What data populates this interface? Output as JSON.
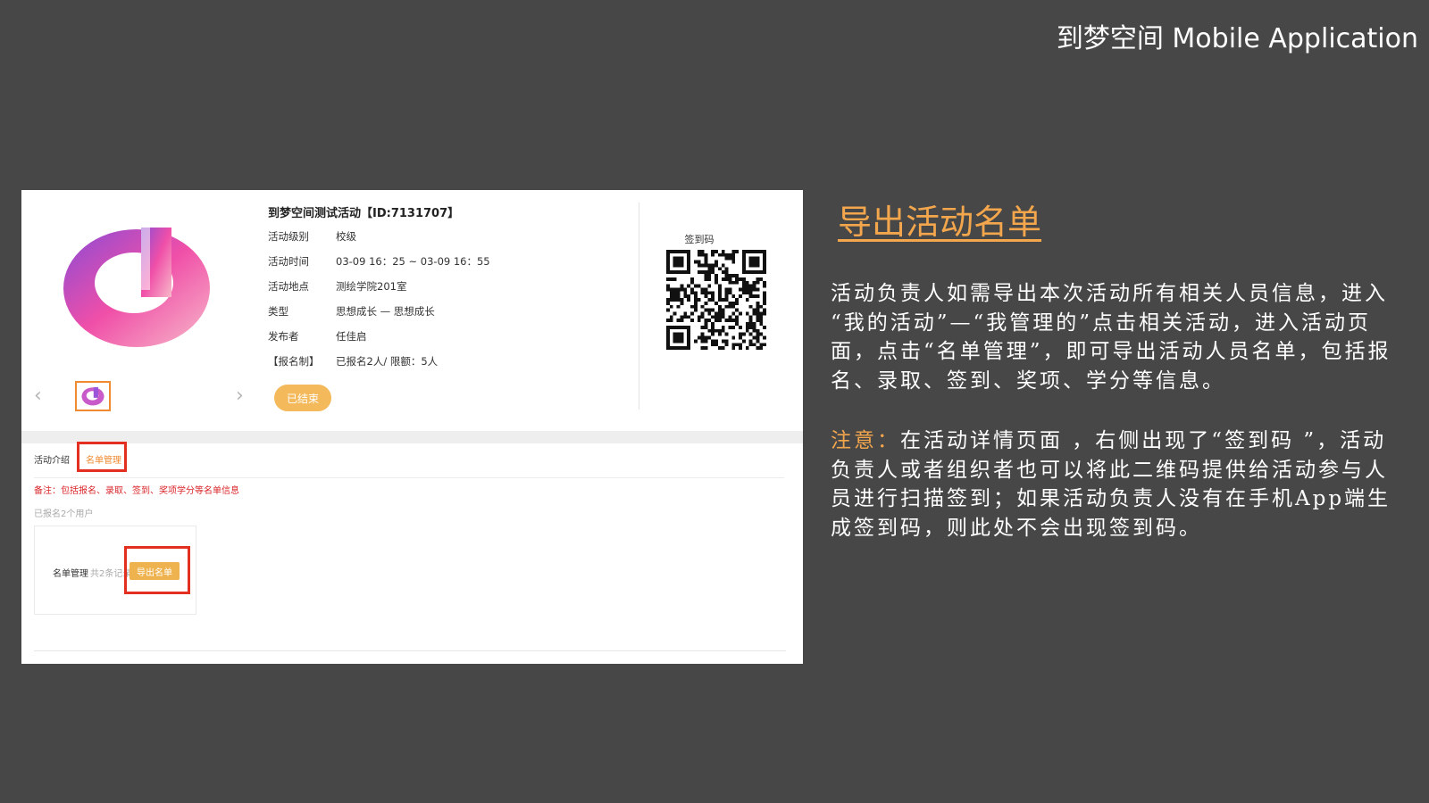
{
  "slide": {
    "title": "到梦空间 Mobile Application",
    "heading": "导出活动名单",
    "description": "活动负责人如需导出本次活动所有相关人员信息，进入 “我的活动”—“我管理的”点击相关活动，进入活动页面，点击“名单管理”，即可导出活动人员名单，包括报名、录取、签到、奖项、学分等信息。",
    "note_label": "注意：",
    "note_text": "在活动详情页面 ，右侧出现了“签到码 ”，活动负责人或者组织者也可以将此二维码提供给活动参与人员进行扫描签到；如果活动负责人没有在手机App端生成签到码，则此处不会出现签到码。"
  },
  "activity": {
    "title": "到梦空间测试活动【ID:7131707】",
    "fields": [
      {
        "key": "活动级别",
        "value": "校级"
      },
      {
        "key": "活动时间",
        "value": "03-09 16：25 ~ 03-09 16：55"
      },
      {
        "key": "活动地点",
        "value": "测绘学院201室"
      },
      {
        "key": "类型",
        "value": "思想成长 — 思想成长"
      },
      {
        "key": "发布者",
        "value": "任佳启"
      },
      {
        "key": "【报名制】",
        "value": "已报名2人/ 限额：5人"
      }
    ],
    "status": "已结束",
    "qr_label": "签到码"
  },
  "tabs": {
    "intro": "活动介绍",
    "roster": "名单管理"
  },
  "roster": {
    "note": "备注：包括报名、录取、签到、奖项学分等名单信息",
    "signed_count": "已报名2个用户",
    "card_label": "名单管理",
    "card_count": "共2条记录",
    "export_label": "导出名单"
  },
  "colors": {
    "background": "#474747",
    "accent": "#f3a64c",
    "highlight": "#e32f1f",
    "status_button": "#f3b95a"
  }
}
